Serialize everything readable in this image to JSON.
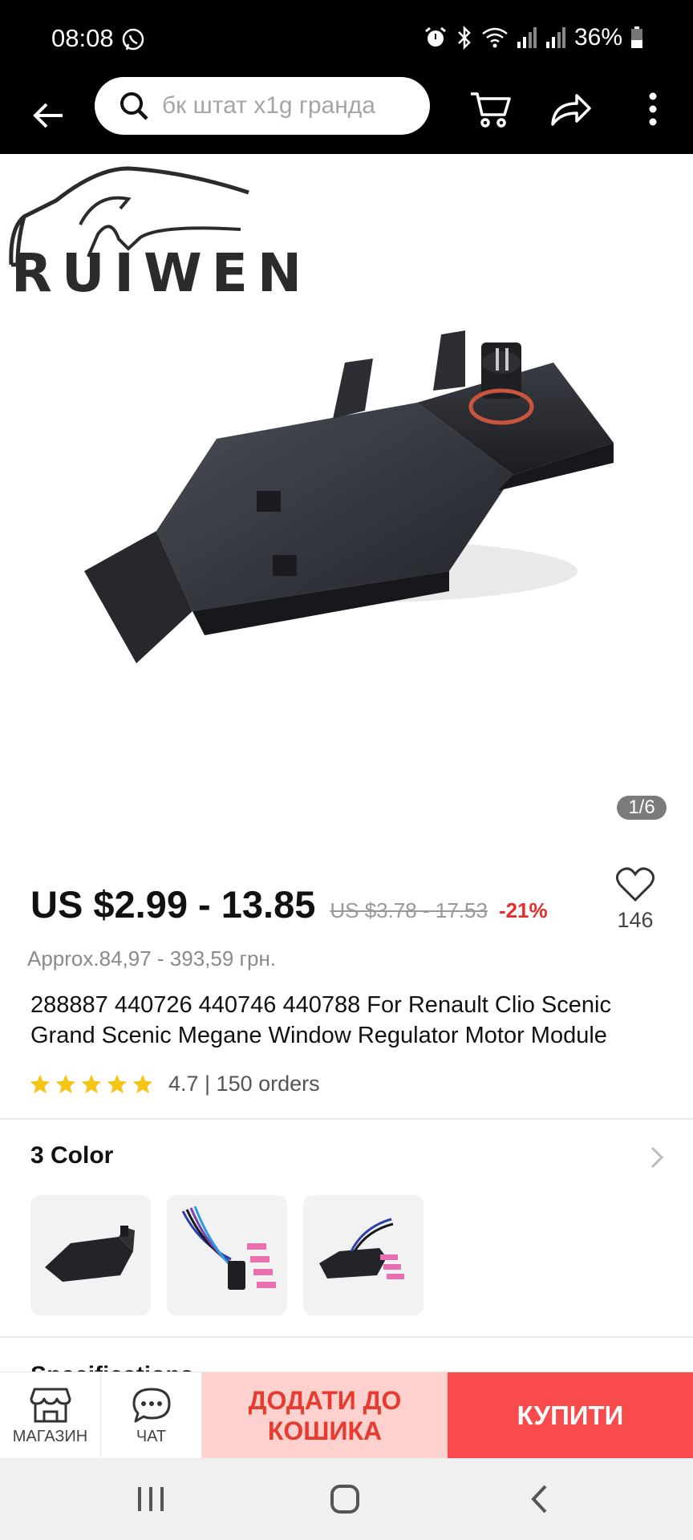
{
  "status_bar": {
    "time": "08:08",
    "battery": "36%",
    "icons": [
      "viber-icon",
      "alarm-icon",
      "bluetooth-icon",
      "wifi-icon",
      "signal-icon",
      "signal-icon-2",
      "battery-icon"
    ]
  },
  "search": {
    "placeholder": "бк штат x1g гранда"
  },
  "toolbar": {
    "icons": [
      "back-arrow-icon",
      "search-icon",
      "cart-icon",
      "share-icon",
      "more-vert-icon"
    ]
  },
  "gallery": {
    "brand": "RUIWEN",
    "counter": "1/6"
  },
  "product": {
    "price": "US $2.99 - 13.85",
    "old_price": "US $3.78 - 17.53",
    "discount": "-21%",
    "wishlist_count": "146",
    "approx_price": "Approx.84,97 - 393,59 грн.",
    "title": "288887 440726 440746 440788 For Renault Clio Scenic Grand Scenic Megane Window Regulator Motor Module",
    "rating_text": "4.7 | 150 orders",
    "rating_value": 4.7,
    "rating_max": 5
  },
  "colors": {
    "title": "3 Color",
    "items": [
      "module",
      "cable-harness",
      "module-with-harness"
    ]
  },
  "specifications": {
    "title": "Specifications"
  },
  "action_bar": {
    "store_label": "МАГАЗИН",
    "chat_label": "ЧАТ",
    "add_to_cart_line1": "ДОДАТИ ДО",
    "add_to_cart_line2": "КОШИКА",
    "buy_label": "КУПИТИ"
  },
  "colors_theme": {
    "accent": "#f94b4b",
    "accent_light": "#ffd1ce",
    "discount": "#e62e2e",
    "star": "#f5c518"
  }
}
